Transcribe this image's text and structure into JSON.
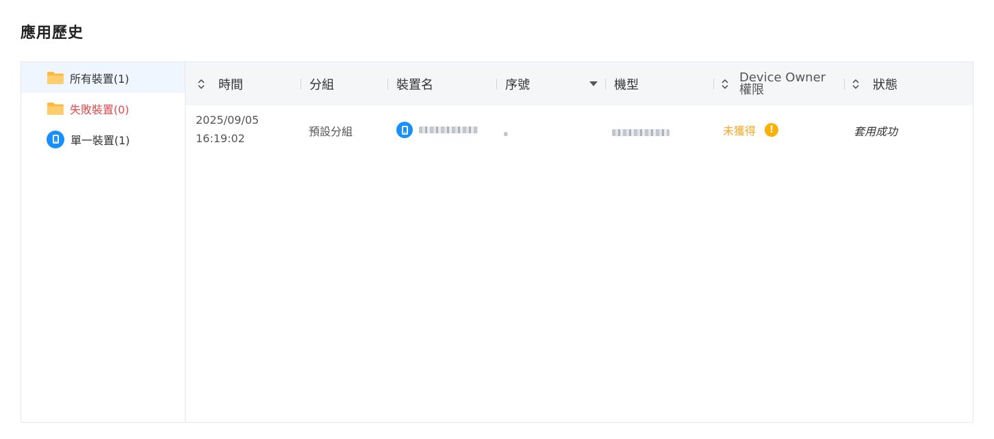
{
  "page": {
    "title": "應用歷史"
  },
  "sidebar": {
    "items": [
      {
        "label": "所有裝置(1)",
        "icon": "folder-icon",
        "active": true
      },
      {
        "label": "失敗裝置(0)",
        "icon": "folder-icon",
        "status": "failed"
      },
      {
        "label": "單一裝置(1)",
        "icon": "phone-icon"
      }
    ]
  },
  "table": {
    "headers": {
      "time": "時間",
      "group": "分組",
      "device_name": "裝置名",
      "serial": "序號",
      "model": "機型",
      "device_owner_line1": "Device Owner",
      "device_owner_line2": "權限",
      "status": "狀態"
    },
    "rows": [
      {
        "date": "2025/09/05",
        "time": "16:19:02",
        "group": "預設分組",
        "device_owner": "未獲得",
        "status": "套用成功"
      }
    ]
  },
  "colors": {
    "accent": "#1890ff",
    "failed": "#e5484d",
    "warning": "#fab005",
    "folder": "#ffc04d"
  }
}
